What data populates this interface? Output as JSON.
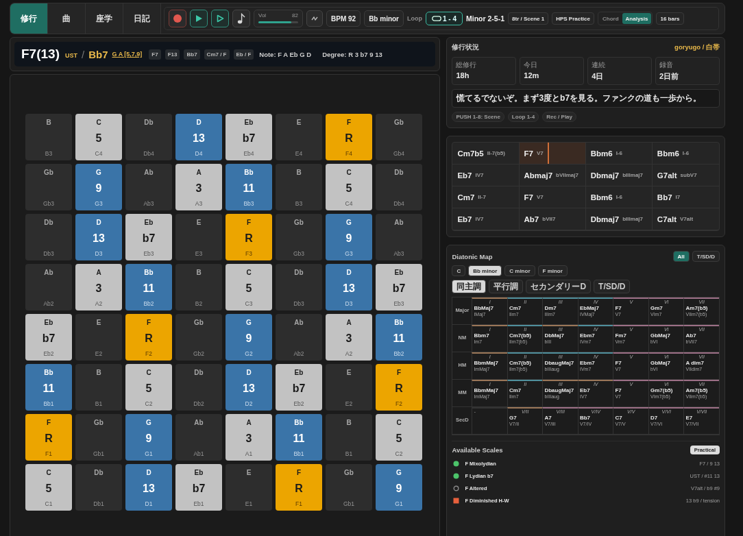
{
  "tabs": [
    {
      "label": "修行",
      "selected": true
    },
    {
      "label": "曲",
      "selected": false
    },
    {
      "label": "座学",
      "selected": false
    },
    {
      "label": "日記",
      "selected": false
    }
  ],
  "transport": {
    "recording": false,
    "volume": {
      "label": "Vol",
      "reading": "82",
      "level": 0.82
    },
    "bpm": "BPM 92",
    "key": "Bb minor",
    "loop_label": "Loop",
    "loop": "1 - 4",
    "progression": "Minor 2-5-1",
    "tracks": "8tr / Scene 1",
    "practice": "HPS Practice",
    "modes": [
      {
        "label": "Chord",
        "selected": false
      },
      {
        "label": "Analysis",
        "selected": true
      }
    ],
    "bars": "16 bars"
  },
  "chord_header": {
    "chord": "F7(13)",
    "ust": "UST",
    "slash": "/",
    "ust_chord": "Bb7",
    "ust_notes": "G A [5,7,9]",
    "aliases": [
      "F7",
      "F13",
      "Bb7",
      "Cm7 / F",
      "Eb / F"
    ],
    "notes": "Note: F A Eb G D",
    "degrees": "Degree: R 3 b7 9 13"
  },
  "pads": [
    [
      {
        "note": "B",
        "octave": "B3",
        "kind": "off"
      },
      {
        "note": "C",
        "degree": "5",
        "octave": "C4",
        "kind": "chord"
      },
      {
        "note": "Db",
        "octave": "Db4",
        "kind": "off"
      },
      {
        "note": "D",
        "degree": "13",
        "octave": "D4",
        "kind": "tension"
      },
      {
        "note": "Eb",
        "degree": "b7",
        "octave": "Eb4",
        "kind": "chord"
      },
      {
        "note": "E",
        "octave": "E4",
        "kind": "off"
      },
      {
        "note": "F",
        "degree": "R",
        "octave": "F4",
        "kind": "root"
      },
      {
        "note": "Gb",
        "octave": "Gb4",
        "kind": "off"
      }
    ],
    [
      {
        "note": "Gb",
        "octave": "Gb3",
        "kind": "off"
      },
      {
        "note": "G",
        "degree": "9",
        "octave": "G3",
        "kind": "tension"
      },
      {
        "note": "Ab",
        "octave": "Ab3",
        "kind": "off"
      },
      {
        "note": "A",
        "degree": "3",
        "octave": "A3",
        "kind": "chord"
      },
      {
        "note": "Bb",
        "degree": "11",
        "octave": "Bb3",
        "kind": "tension"
      },
      {
        "note": "B",
        "octave": "B3",
        "kind": "off"
      },
      {
        "note": "C",
        "degree": "5",
        "octave": "C4",
        "kind": "chord"
      },
      {
        "note": "Db",
        "octave": "Db4",
        "kind": "off"
      }
    ],
    [
      {
        "note": "Db",
        "octave": "Db3",
        "kind": "off"
      },
      {
        "note": "D",
        "degree": "13",
        "octave": "D3",
        "kind": "tension"
      },
      {
        "note": "Eb",
        "degree": "b7",
        "octave": "Eb3",
        "kind": "chord"
      },
      {
        "note": "E",
        "octave": "E3",
        "kind": "off"
      },
      {
        "note": "F",
        "degree": "R",
        "octave": "F3",
        "kind": "root"
      },
      {
        "note": "Gb",
        "octave": "Gb3",
        "kind": "off"
      },
      {
        "note": "G",
        "degree": "9",
        "octave": "G3",
        "kind": "tension"
      },
      {
        "note": "Ab",
        "octave": "Ab3",
        "kind": "off"
      }
    ],
    [
      {
        "note": "Ab",
        "octave": "Ab2",
        "kind": "off"
      },
      {
        "note": "A",
        "degree": "3",
        "octave": "A2",
        "kind": "chord"
      },
      {
        "note": "Bb",
        "degree": "11",
        "octave": "Bb2",
        "kind": "tension"
      },
      {
        "note": "B",
        "octave": "B2",
        "kind": "off"
      },
      {
        "note": "C",
        "degree": "5",
        "octave": "C3",
        "kind": "chord"
      },
      {
        "note": "Db",
        "octave": "Db3",
        "kind": "off"
      },
      {
        "note": "D",
        "degree": "13",
        "octave": "D3",
        "kind": "tension"
      },
      {
        "note": "Eb",
        "degree": "b7",
        "octave": "Eb3",
        "kind": "chord"
      }
    ],
    [
      {
        "note": "Eb",
        "degree": "b7",
        "octave": "Eb2",
        "kind": "chord"
      },
      {
        "note": "E",
        "octave": "E2",
        "kind": "off"
      },
      {
        "note": "F",
        "degree": "R",
        "octave": "F2",
        "kind": "root"
      },
      {
        "note": "Gb",
        "octave": "Gb2",
        "kind": "off"
      },
      {
        "note": "G",
        "degree": "9",
        "octave": "G2",
        "kind": "tension"
      },
      {
        "note": "Ab",
        "octave": "Ab2",
        "kind": "off"
      },
      {
        "note": "A",
        "degree": "3",
        "octave": "A2",
        "kind": "chord"
      },
      {
        "note": "Bb",
        "degree": "11",
        "octave": "Bb2",
        "kind": "tension"
      }
    ],
    [
      {
        "note": "Bb",
        "degree": "11",
        "octave": "Bb1",
        "kind": "tension"
      },
      {
        "note": "B",
        "octave": "B1",
        "kind": "off"
      },
      {
        "note": "C",
        "degree": "5",
        "octave": "C2",
        "kind": "chord"
      },
      {
        "note": "Db",
        "octave": "Db2",
        "kind": "off"
      },
      {
        "note": "D",
        "degree": "13",
        "octave": "D2",
        "kind": "tension"
      },
      {
        "note": "Eb",
        "degree": "b7",
        "octave": "Eb2",
        "kind": "chord"
      },
      {
        "note": "E",
        "octave": "E2",
        "kind": "off"
      },
      {
        "note": "F",
        "degree": "R",
        "octave": "F2",
        "kind": "root"
      }
    ],
    [
      {
        "note": "F",
        "degree": "R",
        "octave": "F1",
        "kind": "root"
      },
      {
        "note": "Gb",
        "octave": "Gb1",
        "kind": "off"
      },
      {
        "note": "G",
        "degree": "9",
        "octave": "G1",
        "kind": "tension"
      },
      {
        "note": "Ab",
        "octave": "Ab1",
        "kind": "off"
      },
      {
        "note": "A",
        "degree": "3",
        "octave": "A1",
        "kind": "chord"
      },
      {
        "note": "Bb",
        "degree": "11",
        "octave": "Bb1",
        "kind": "tension"
      },
      {
        "note": "B",
        "octave": "B1",
        "kind": "off"
      },
      {
        "note": "C",
        "degree": "5",
        "octave": "C2",
        "kind": "chord"
      }
    ],
    [
      {
        "note": "C",
        "degree": "5",
        "octave": "C1",
        "kind": "chord"
      },
      {
        "note": "Db",
        "octave": "Db1",
        "kind": "off"
      },
      {
        "note": "D",
        "degree": "13",
        "octave": "D1",
        "kind": "tension"
      },
      {
        "note": "Eb",
        "degree": "b7",
        "octave": "Eb1",
        "kind": "chord"
      },
      {
        "note": "E",
        "octave": "E1",
        "kind": "off"
      },
      {
        "note": "F",
        "degree": "R",
        "octave": "F1",
        "kind": "root"
      },
      {
        "note": "Gb",
        "octave": "Gb1",
        "kind": "off"
      },
      {
        "note": "G",
        "degree": "9",
        "octave": "G1",
        "kind": "tension"
      }
    ]
  ],
  "status": {
    "title": "修行状況",
    "user": "goryugo / 白帯",
    "stats": [
      {
        "label": "総修行",
        "value": "18h"
      },
      {
        "label": "今日",
        "value": "12m"
      },
      {
        "label": "連続",
        "value": "4日"
      },
      {
        "label": "録音",
        "value": "2日前"
      }
    ],
    "message": "慌てるでないぞ。まず3度とb7を見る。ファンクの道も一歩から。",
    "hints": [
      "PUSH 1-8: Scene",
      "Loop 1-4",
      "Rec / Play"
    ]
  },
  "progression": [
    {
      "chord": "Cm7b5",
      "roman": "II-7(b5)",
      "selected": false
    },
    {
      "chord": "F7",
      "roman": "V7",
      "selected": true
    },
    {
      "chord": "Bbm6",
      "roman": "I-6",
      "selected": false
    },
    {
      "chord": "Bbm6",
      "roman": "I-6",
      "selected": false
    },
    {
      "chord": "Eb7",
      "roman": "IV7",
      "selected": false
    },
    {
      "chord": "Abmaj7",
      "roman": "bVIImaj7",
      "selected": false
    },
    {
      "chord": "Dbmaj7",
      "roman": "bIIImaj7",
      "selected": false
    },
    {
      "chord": "G7alt",
      "roman": "subV7",
      "selected": false
    },
    {
      "chord": "Cm7",
      "roman": "II-7",
      "selected": false
    },
    {
      "chord": "F7",
      "roman": "V7",
      "selected": false
    },
    {
      "chord": "Bbm6",
      "roman": "I-6",
      "selected": false
    },
    {
      "chord": "Bb7",
      "roman": "I7",
      "selected": false
    },
    {
      "chord": "Eb7",
      "roman": "IV7",
      "selected": false
    },
    {
      "chord": "Ab7",
      "roman": "bVII7",
      "selected": false
    },
    {
      "chord": "Dbmaj7",
      "roman": "bIIImaj7",
      "selected": false
    },
    {
      "chord": "C7alt",
      "roman": "V7alt",
      "selected": false
    }
  ],
  "diatonic_map": {
    "title": "Diatonic Map",
    "views": [
      {
        "label": "All",
        "selected": true
      },
      {
        "label": "T/SD/D",
        "selected": false
      }
    ],
    "keys": [
      {
        "label": "C",
        "selected": false
      },
      {
        "label": "Bb minor",
        "selected": true
      },
      {
        "label": "C minor",
        "selected": false
      },
      {
        "label": "F minor",
        "selected": false
      }
    ],
    "modes": [
      {
        "label": "同主調",
        "selected": true
      },
      {
        "label": "平行調",
        "selected": false
      },
      {
        "label": "セカンダリーD",
        "selected": false
      },
      {
        "label": "T/SD/D",
        "selected": false
      }
    ],
    "rows": [
      {
        "label": "Major",
        "cells": [
          {
            "degree": "I",
            "chord": "BbMaj7",
            "function": "IMaj7",
            "color": "#9a7658"
          },
          {
            "degree": "II",
            "chord": "Cm7",
            "function": "IIm7",
            "color": "#4f8f9c"
          },
          {
            "degree": "III",
            "chord": "Dm7",
            "function": "IIIm7",
            "color": "#4f8f9c"
          },
          {
            "degree": "IV",
            "chord": "EbMaj7",
            "function": "IVMaj7",
            "color": "#4f8f9c"
          },
          {
            "degree": "V",
            "chord": "F7",
            "function": "V7",
            "color": "#9c6f86"
          },
          {
            "degree": "VI",
            "chord": "Gm7",
            "function": "VIm7",
            "color": "#9c6f86"
          },
          {
            "degree": "VII",
            "chord": "Am7(b5)",
            "function": "VIIm7(b5)",
            "color": "#9c6f86"
          }
        ]
      },
      {
        "label": "NM",
        "cells": [
          {
            "degree": "I",
            "chord": "Bbm7",
            "function": "Im7",
            "color": "#9a7658"
          },
          {
            "degree": "II",
            "chord": "Cm7(b5)",
            "function": "IIm7(b5)",
            "color": "#4f8f9c"
          },
          {
            "degree": "III",
            "chord": "DbMaj7",
            "function": "bIII",
            "color": "#9a7658"
          },
          {
            "degree": "IV",
            "chord": "Ebm7",
            "function": "IVm7",
            "color": "#4f8f9c"
          },
          {
            "degree": "V",
            "chord": "Fm7",
            "function": "Vm7",
            "color": "#9c6f86"
          },
          {
            "degree": "VI",
            "chord": "GbMaj7",
            "function": "bVI",
            "color": "#9c6f86"
          },
          {
            "degree": "VII",
            "chord": "Ab7",
            "function": "bVII7",
            "color": "#9c6f86"
          }
        ]
      },
      {
        "label": "HM",
        "cells": [
          {
            "degree": "I",
            "chord": "BbmMaj7",
            "function": "ImMaj7",
            "color": "#9a7658"
          },
          {
            "degree": "II",
            "chord": "Cm7(b5)",
            "function": "IIm7(b5)",
            "color": "#4f8f9c"
          },
          {
            "degree": "III",
            "chord": "DbaugMaj7",
            "function": "bIIIaug",
            "color": "#4f8f9c"
          },
          {
            "degree": "IV",
            "chord": "Ebm7",
            "function": "IVm7",
            "color": "#4f8f9c"
          },
          {
            "degree": "V",
            "chord": "F7",
            "function": "V7",
            "color": "#9c6f86"
          },
          {
            "degree": "VI",
            "chord": "GbMaj7",
            "function": "bVI",
            "color": "#9c6f86"
          },
          {
            "degree": "VII",
            "chord": "A dim7",
            "function": "VIIdim7",
            "color": "#9c6f86"
          }
        ]
      },
      {
        "label": "MM",
        "cells": [
          {
            "degree": "I",
            "chord": "BbmMaj7",
            "function": "ImMaj7",
            "color": "#9a7658"
          },
          {
            "degree": "II",
            "chord": "Cm7",
            "function": "IIm7",
            "color": "#4f8f9c"
          },
          {
            "degree": "III",
            "chord": "DbaugMaj7",
            "function": "bIIIaug",
            "color": "#9a7658"
          },
          {
            "degree": "IV",
            "chord": "Eb7",
            "function": "IV7",
            "color": "#9a7658"
          },
          {
            "degree": "V",
            "chord": "F7",
            "function": "V7",
            "color": "#9c6f86"
          },
          {
            "degree": "VI",
            "chord": "Gm7(b5)",
            "function": "VIm7(b5)",
            "color": "#9c6f86"
          },
          {
            "degree": "VII",
            "chord": "Am7(b5)",
            "function": "VIIm7(b5)",
            "color": "#9c6f86"
          }
        ]
      },
      {
        "label": "SecD",
        "cells": [
          {
            "degree": "-"
          },
          {
            "degree": "V/II",
            "chord": "G7",
            "function": "V7/II",
            "color": "#9a7658"
          },
          {
            "degree": "V/III",
            "chord": "A7",
            "function": "V7/III",
            "color": "#9c6f86"
          },
          {
            "degree": "V/IV",
            "chord": "Bb7",
            "function": "V7/IV",
            "color": "#9c6f86"
          },
          {
            "degree": "V/V",
            "chord": "C7",
            "function": "V7/V",
            "color": "#9c6f86"
          },
          {
            "degree": "V/VI",
            "chord": "D7",
            "function": "V7/VI",
            "color": "#9c6f86"
          },
          {
            "degree": "V/VII",
            "chord": "E7",
            "function": "V7/VII",
            "color": "#9c6f86"
          }
        ]
      }
    ]
  },
  "scales": {
    "title": "Available Scales",
    "badge": "Practical",
    "items": [
      {
        "name": "F Mixolydian",
        "note": "F7 / 9 13",
        "kind": "dot",
        "color": "#4cc46a"
      },
      {
        "name": "F Lydian b7",
        "note": "UST / #11 13",
        "kind": "dot",
        "color": "#4cc46a"
      },
      {
        "name": "F Altered",
        "note": "V7alt / b9 #9",
        "kind": "ring",
        "color": "#8a8a8a"
      },
      {
        "name": "F Diminished H-W",
        "note": "13 b9 / tension",
        "kind": "square",
        "color": "#e8603c"
      }
    ]
  }
}
